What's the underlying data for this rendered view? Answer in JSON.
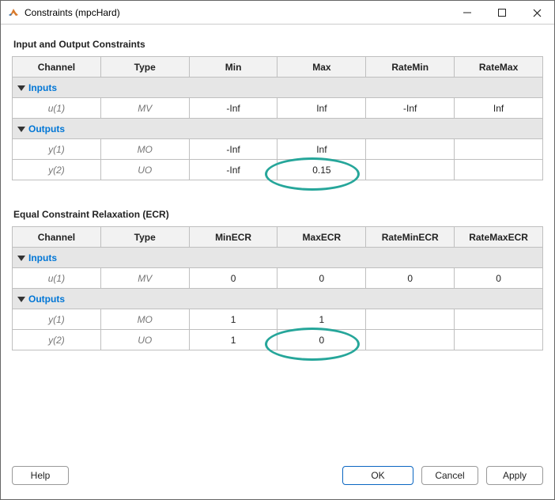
{
  "window": {
    "title": "Constraints (mpcHard)"
  },
  "section1": {
    "title": "Input and Output Constraints",
    "headers": [
      "Channel",
      "Type",
      "Min",
      "Max",
      "RateMin",
      "RateMax"
    ],
    "groups": {
      "inputs_label": "Inputs",
      "outputs_label": "Outputs"
    },
    "rows": {
      "u1": {
        "channel": "u(1)",
        "type": "MV",
        "min": "-Inf",
        "max": "Inf",
        "ratemin": "-Inf",
        "ratemax": "Inf"
      },
      "y1": {
        "channel": "y(1)",
        "type": "MO",
        "min": "-Inf",
        "max": "Inf",
        "ratemin": "",
        "ratemax": ""
      },
      "y2": {
        "channel": "y(2)",
        "type": "UO",
        "min": "-Inf",
        "max": "0.15",
        "ratemin": "",
        "ratemax": ""
      }
    }
  },
  "section2": {
    "title": "Equal Constraint Relaxation (ECR)",
    "headers": [
      "Channel",
      "Type",
      "MinECR",
      "MaxECR",
      "RateMinECR",
      "RateMaxECR"
    ],
    "groups": {
      "inputs_label": "Inputs",
      "outputs_label": "Outputs"
    },
    "rows": {
      "u1": {
        "channel": "u(1)",
        "type": "MV",
        "min": "0",
        "max": "0",
        "ratemin": "0",
        "ratemax": "0"
      },
      "y1": {
        "channel": "y(1)",
        "type": "MO",
        "min": "1",
        "max": "1",
        "ratemin": "",
        "ratemax": ""
      },
      "y2": {
        "channel": "y(2)",
        "type": "UO",
        "min": "1",
        "max": "0",
        "ratemin": "",
        "ratemax": ""
      }
    }
  },
  "buttons": {
    "help": "Help",
    "ok": "OK",
    "cancel": "Cancel",
    "apply": "Apply"
  },
  "highlights": {
    "circle1_value": "0.15",
    "circle2_value": "0"
  }
}
